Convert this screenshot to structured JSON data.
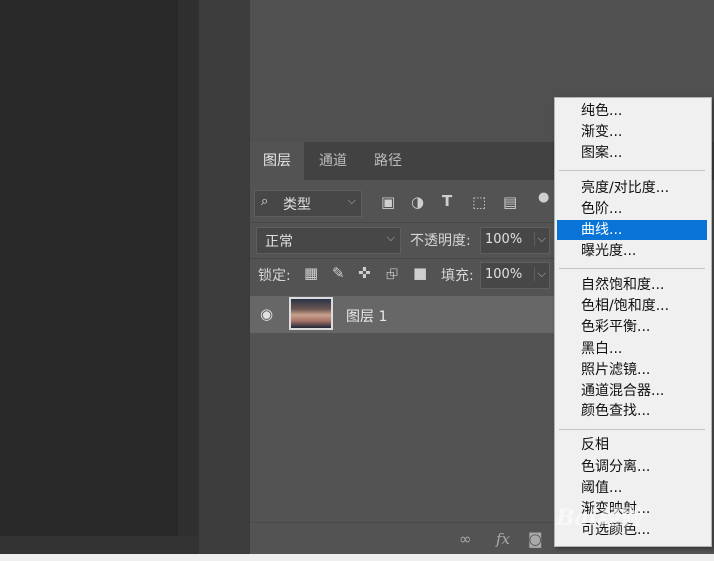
{
  "tabs": [
    "图层",
    "通道",
    "路径"
  ],
  "filter": {
    "icon": "search-icon",
    "label": "类型"
  },
  "blend": {
    "mode": "正常",
    "opacity_label": "不透明度:",
    "opacity_value": "100%"
  },
  "lock": {
    "label": "锁定:",
    "fill_label": "填充:",
    "fill_value": "100%"
  },
  "layer": {
    "name": "图层 1"
  },
  "menu": {
    "group1": [
      "纯色...",
      "渐变...",
      "图案..."
    ],
    "group2": [
      "亮度/对比度...",
      "色阶...",
      "曲线...",
      "曝光度..."
    ],
    "group3": [
      "自然饱和度...",
      "色相/饱和度...",
      "色彩平衡...",
      "黑白...",
      "照片滤镜...",
      "通道混合器...",
      "颜色查找..."
    ],
    "group4": [
      "反相",
      "色调分离...",
      "阈值...",
      "渐变映射...",
      "可选颜色..."
    ],
    "selected": "曲线..."
  },
  "colors": {
    "menu_highlight": "#0a74d6",
    "panel_bg": "#535353",
    "canvas_bg": "#282828"
  },
  "watermark": "Bai经验"
}
